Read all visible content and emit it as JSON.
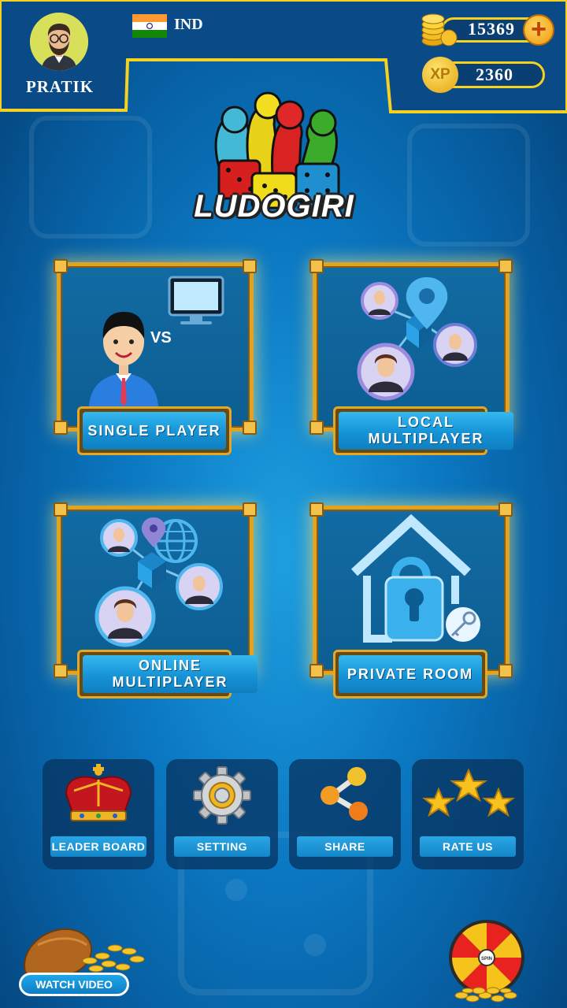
{
  "player": {
    "name": "PRATIK",
    "country": "IND"
  },
  "wallet": {
    "coins": "15369",
    "xp_label": "XP",
    "xp": "2360",
    "add_coins": "+"
  },
  "logo": {
    "text": "LUDOGIRI"
  },
  "modes": [
    {
      "label": "SINGLE PLAYER",
      "vs": "VS"
    },
    {
      "label": "LOCAL MULTIPLAYER"
    },
    {
      "label": "ONLINE MULTIPLAYER"
    },
    {
      "label": "PRIVATE ROOM"
    }
  ],
  "menu": [
    {
      "label": "LEADER BOARD",
      "icon": "crown-icon"
    },
    {
      "label": "SETTING",
      "icon": "gear-icon"
    },
    {
      "label": "SHARE",
      "icon": "share-icon"
    },
    {
      "label": "RATE US",
      "icon": "stars-icon"
    }
  ],
  "extras": {
    "watch_video": "WATCH VIDEO",
    "spin": "SPIN"
  },
  "colors": {
    "accent_yellow": "#f4d21f",
    "frame_gold": "#e0a322",
    "button_blue": "#1593d6",
    "bg_blue": "#0b78c2"
  }
}
